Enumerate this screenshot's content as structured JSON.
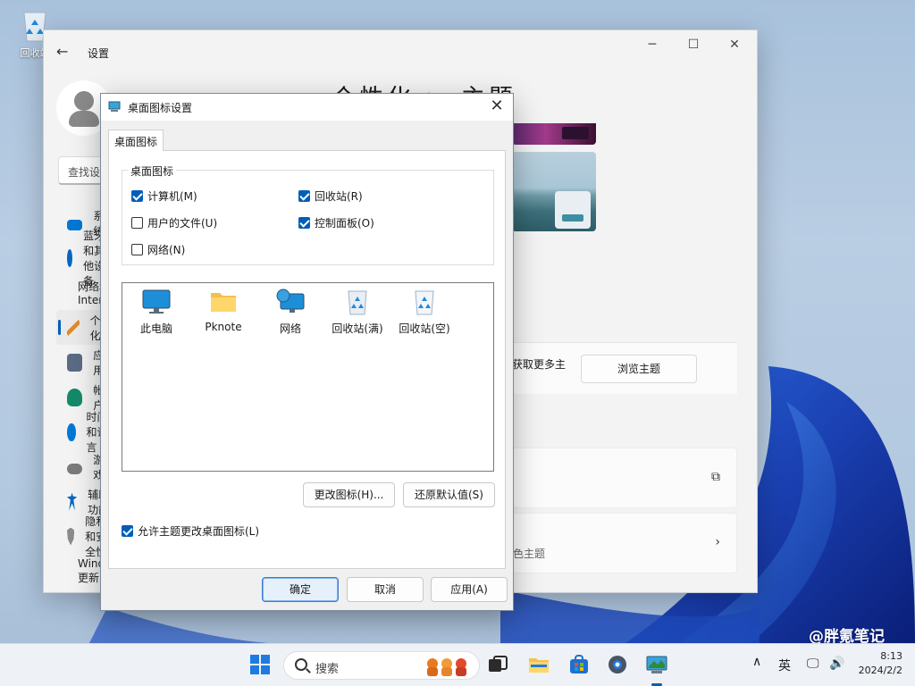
{
  "desktop": {
    "recycle_label": "回收站"
  },
  "settings": {
    "app_title": "设置",
    "search_placeholder": "查找设置",
    "heading": "个性化 > 主题",
    "nav": [
      {
        "icon": "system-icon",
        "label": "系统",
        "color": "#0078d4"
      },
      {
        "icon": "bluetooth-icon",
        "label": "蓝牙和其他设备",
        "color": "#0067c0"
      },
      {
        "icon": "wifi-icon",
        "label": "网络和 Internet",
        "color": "#0078d4"
      },
      {
        "icon": "brush-icon",
        "label": "个性化",
        "color": "#e08a2a"
      },
      {
        "icon": "apps-icon",
        "label": "应用",
        "color": "#5a6b84"
      },
      {
        "icon": "accounts-icon",
        "label": "帐户",
        "color": "#138a6b"
      },
      {
        "icon": "time-icon",
        "label": "时间和语言",
        "color": "#0078d4"
      },
      {
        "icon": "gaming-icon",
        "label": "游戏",
        "color": "#6b6b6b"
      },
      {
        "icon": "accessibility-icon",
        "label": "辅助功能",
        "color": "#0067c0"
      },
      {
        "icon": "shield-icon",
        "label": "隐私和安全性",
        "color": "#7a7a7a"
      },
      {
        "icon": "update-icon",
        "label": "Windows 更新",
        "color": "#0078d4"
      }
    ],
    "more_themes_text": "获取更多主",
    "browse_themes": "浏览主题",
    "contrast_sub": "色主题"
  },
  "dialog": {
    "title": "桌面图标设置",
    "tab": "桌面图标",
    "group_legend": "桌面图标",
    "checkboxes": [
      {
        "label": "计算机(M)",
        "checked": true
      },
      {
        "label": "回收站(R)",
        "checked": true
      },
      {
        "label": "用户的文件(U)",
        "checked": false
      },
      {
        "label": "控制面板(O)",
        "checked": true
      },
      {
        "label": "网络(N)",
        "checked": false
      }
    ],
    "icons": [
      {
        "label": "此电脑",
        "icon": "monitor-icon"
      },
      {
        "label": "Pknote",
        "icon": "folder-icon"
      },
      {
        "label": "网络",
        "icon": "network-icon"
      },
      {
        "label": "回收站(满)",
        "icon": "recycle-bin-full-icon"
      },
      {
        "label": "回收站(空)",
        "icon": "recycle-bin-empty-icon"
      }
    ],
    "change_icon": "更改图标(H)...",
    "restore_default": "还原默认值(S)",
    "allow_themes": "允许主题更改桌面图标(L)",
    "allow_themes_checked": true,
    "ok": "确定",
    "cancel": "取消",
    "apply": "应用(A)"
  },
  "taskbar": {
    "search": "搜索",
    "ime": "英",
    "time": "8:13",
    "date": "2024/2/2"
  },
  "watermark": "@胖氪笔记",
  "colors": {
    "accent": "#005fb8",
    "wallpaper": "#1f4fb8"
  }
}
